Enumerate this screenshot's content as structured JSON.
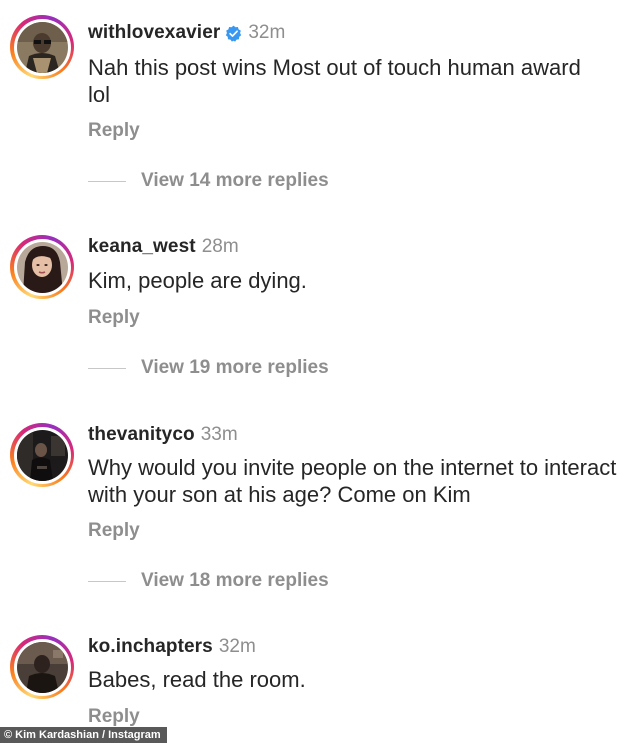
{
  "comments": [
    {
      "username": "withlovexavier",
      "verified": true,
      "time": "32m",
      "text": "Nah this post wins Most out of touch human award lol",
      "reply_label": "Reply",
      "view_replies": "View 14 more replies",
      "avatar_icon": "avatar-man-glasses"
    },
    {
      "username": "keana_west",
      "verified": false,
      "time": "28m",
      "text": "Kim, people are dying.",
      "reply_label": "Reply",
      "view_replies": "View 19 more replies",
      "avatar_icon": "avatar-woman-dark-hair"
    },
    {
      "username": "thevanityco",
      "verified": false,
      "time": "33m",
      "text": "Why would you invite people on the internet to interact with your son at his age? Come on Kim",
      "reply_label": "Reply",
      "view_replies": "View 18 more replies",
      "avatar_icon": "avatar-dark-room"
    },
    {
      "username": "ko.inchapters",
      "verified": false,
      "time": "32m",
      "text": "Babes, read the room.",
      "reply_label": "Reply",
      "avatar_icon": "avatar-person-dim"
    }
  ],
  "credit": "© Kim Kardashian / Instagram",
  "colors": {
    "text": "#262626",
    "secondary": "#8e8e8e",
    "verified_blue": "#3897f0"
  }
}
